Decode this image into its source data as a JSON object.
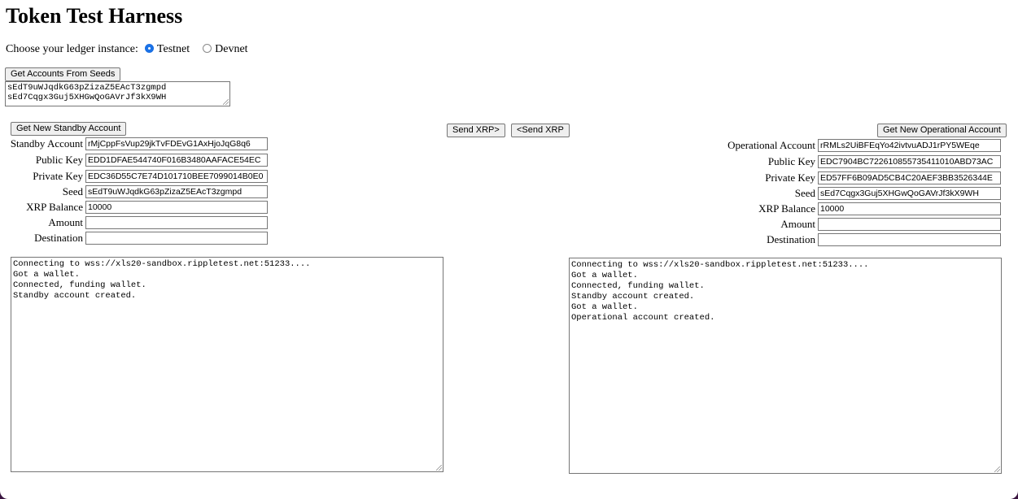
{
  "page": {
    "title": "Token Test Harness"
  },
  "ledger": {
    "label": "Choose your ledger instance:",
    "options": [
      {
        "label": "Testnet",
        "checked": true
      },
      {
        "label": "Devnet",
        "checked": false
      }
    ]
  },
  "seeds": {
    "button_label": "Get Accounts From Seeds",
    "value_lines": [
      "sEdT9uWJqdkG63pZizaZ5EAcT3zgmpd",
      "sEd7Cqgx3Guj5XHGwQoGAVrJf3kX9WH"
    ]
  },
  "actions": {
    "send_xrp_right": "Send XRP>",
    "send_xrp_left": "<Send XRP"
  },
  "standby": {
    "button_label": "Get New Standby Account",
    "fields": [
      {
        "label": "Standby Account",
        "value": "rMjCppFsVup29jkTvFDEvG1AxHjoJqG8q6"
      },
      {
        "label": "Public Key",
        "value": "EDD1DFAE544740F016B3480AAFACE54EC"
      },
      {
        "label": "Private Key",
        "value": "EDC36D55C7E74D101710BEE7099014B0E0"
      },
      {
        "label": "Seed",
        "value": "sEdT9uWJqdkG63pZizaZ5EAcT3zgmpd"
      },
      {
        "label": "XRP Balance",
        "value": "10000"
      },
      {
        "label": "Amount",
        "value": ""
      },
      {
        "label": "Destination",
        "value": ""
      }
    ],
    "log": "Connecting to wss://xls20-sandbox.rippletest.net:51233....\nGot a wallet.\nConnected, funding wallet.\nStandby account created."
  },
  "operational": {
    "button_label": "Get New Operational Account",
    "fields": [
      {
        "label": "Operational Account",
        "value": "rRMLs2UiBFEqYo42ivtvuADJ1rPY5WEqe"
      },
      {
        "label": "Public Key",
        "value": "EDC7904BC722610855735411010ABD73AC"
      },
      {
        "label": "Private Key",
        "value": "ED57FF6B09AD5CB4C20AEF3BB3526344E"
      },
      {
        "label": "Seed",
        "value": "sEd7Cqgx3Guj5XHGwQoGAVrJf3kX9WH"
      },
      {
        "label": "XRP Balance",
        "value": "10000"
      },
      {
        "label": "Amount",
        "value": ""
      },
      {
        "label": "Destination",
        "value": ""
      }
    ],
    "log": "Connecting to wss://xls20-sandbox.rippletest.net:51233....\nGot a wallet.\nConnected, funding wallet.\nStandby account created.\nGot a wallet.\nOperational account created."
  }
}
